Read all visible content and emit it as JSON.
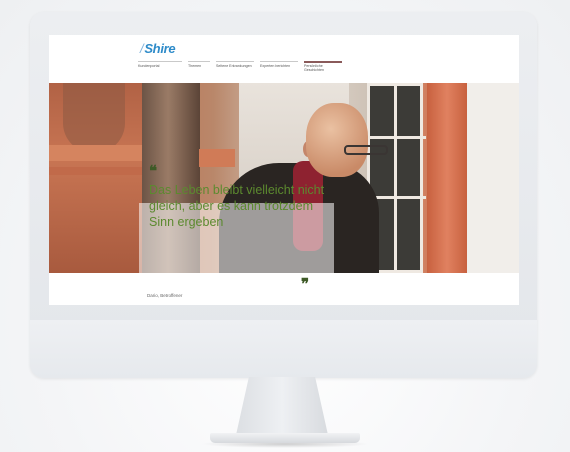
{
  "website": {
    "logo": {
      "mark": "/",
      "text": "Shire"
    },
    "nav": [
      "Kundenportal",
      "Themen",
      "Seltene Erkrankungen",
      "Experten berichten",
      "Persönliche Geschichten"
    ],
    "quote": {
      "open_mark": "❝",
      "text": "Das Leben bleibt vielleicht nicht gleich, aber es kann trotzdem Sinn ergeben",
      "close_mark": "❞"
    },
    "caption": "Dario, Betroffener"
  },
  "colors": {
    "logo": "#2e8bc9",
    "quote_text": "#5c8a2f",
    "quote_marks": "#3e5a27",
    "monitor_bezel": "#e6e9ed"
  }
}
